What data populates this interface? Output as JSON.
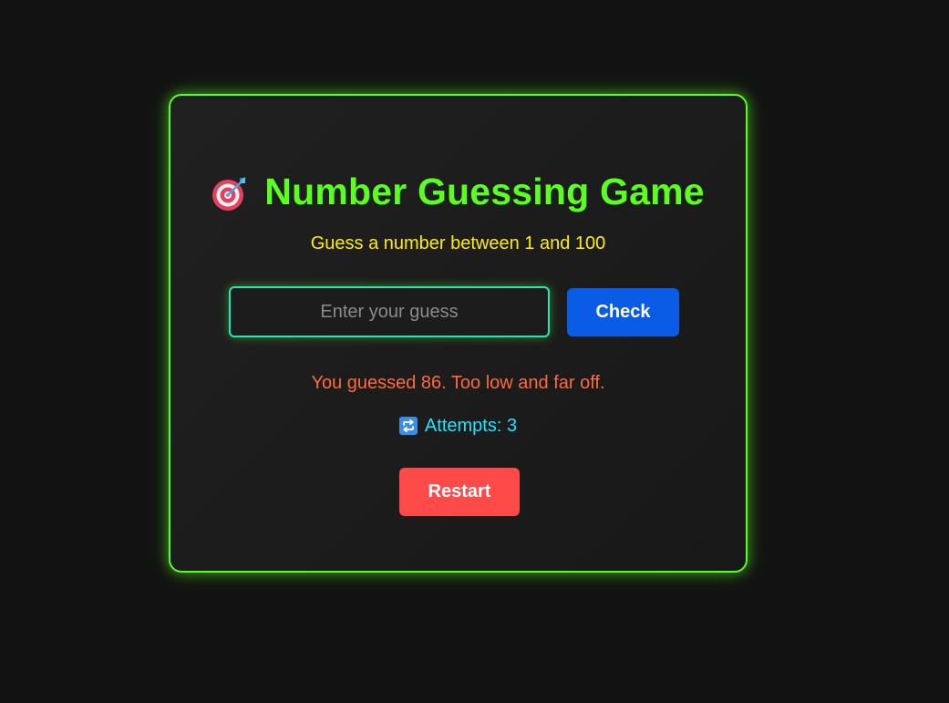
{
  "colors": {
    "page_background": "#121212",
    "card_border": "#5aff1e",
    "title": "#5aff1e",
    "subtitle": "#ffee00",
    "input_border": "#1ee6c0",
    "check_button": "#0a5ce6",
    "message": "#ff6a3d",
    "attempts": "#1ee6ff",
    "restart_button": "#ff4a4a"
  },
  "game": {
    "title_icon": "target-dart-icon",
    "title": "Number Guessing Game",
    "subtitle": "Guess a number between 1 and 100",
    "input_placeholder": "Enter your guess",
    "input_value": "",
    "check_label": "Check",
    "message": "You guessed 86. Too low and far off.",
    "attempts_icon": "repeat-icon",
    "attempts_text": "Attempts: 3",
    "restart_label": "Restart"
  }
}
